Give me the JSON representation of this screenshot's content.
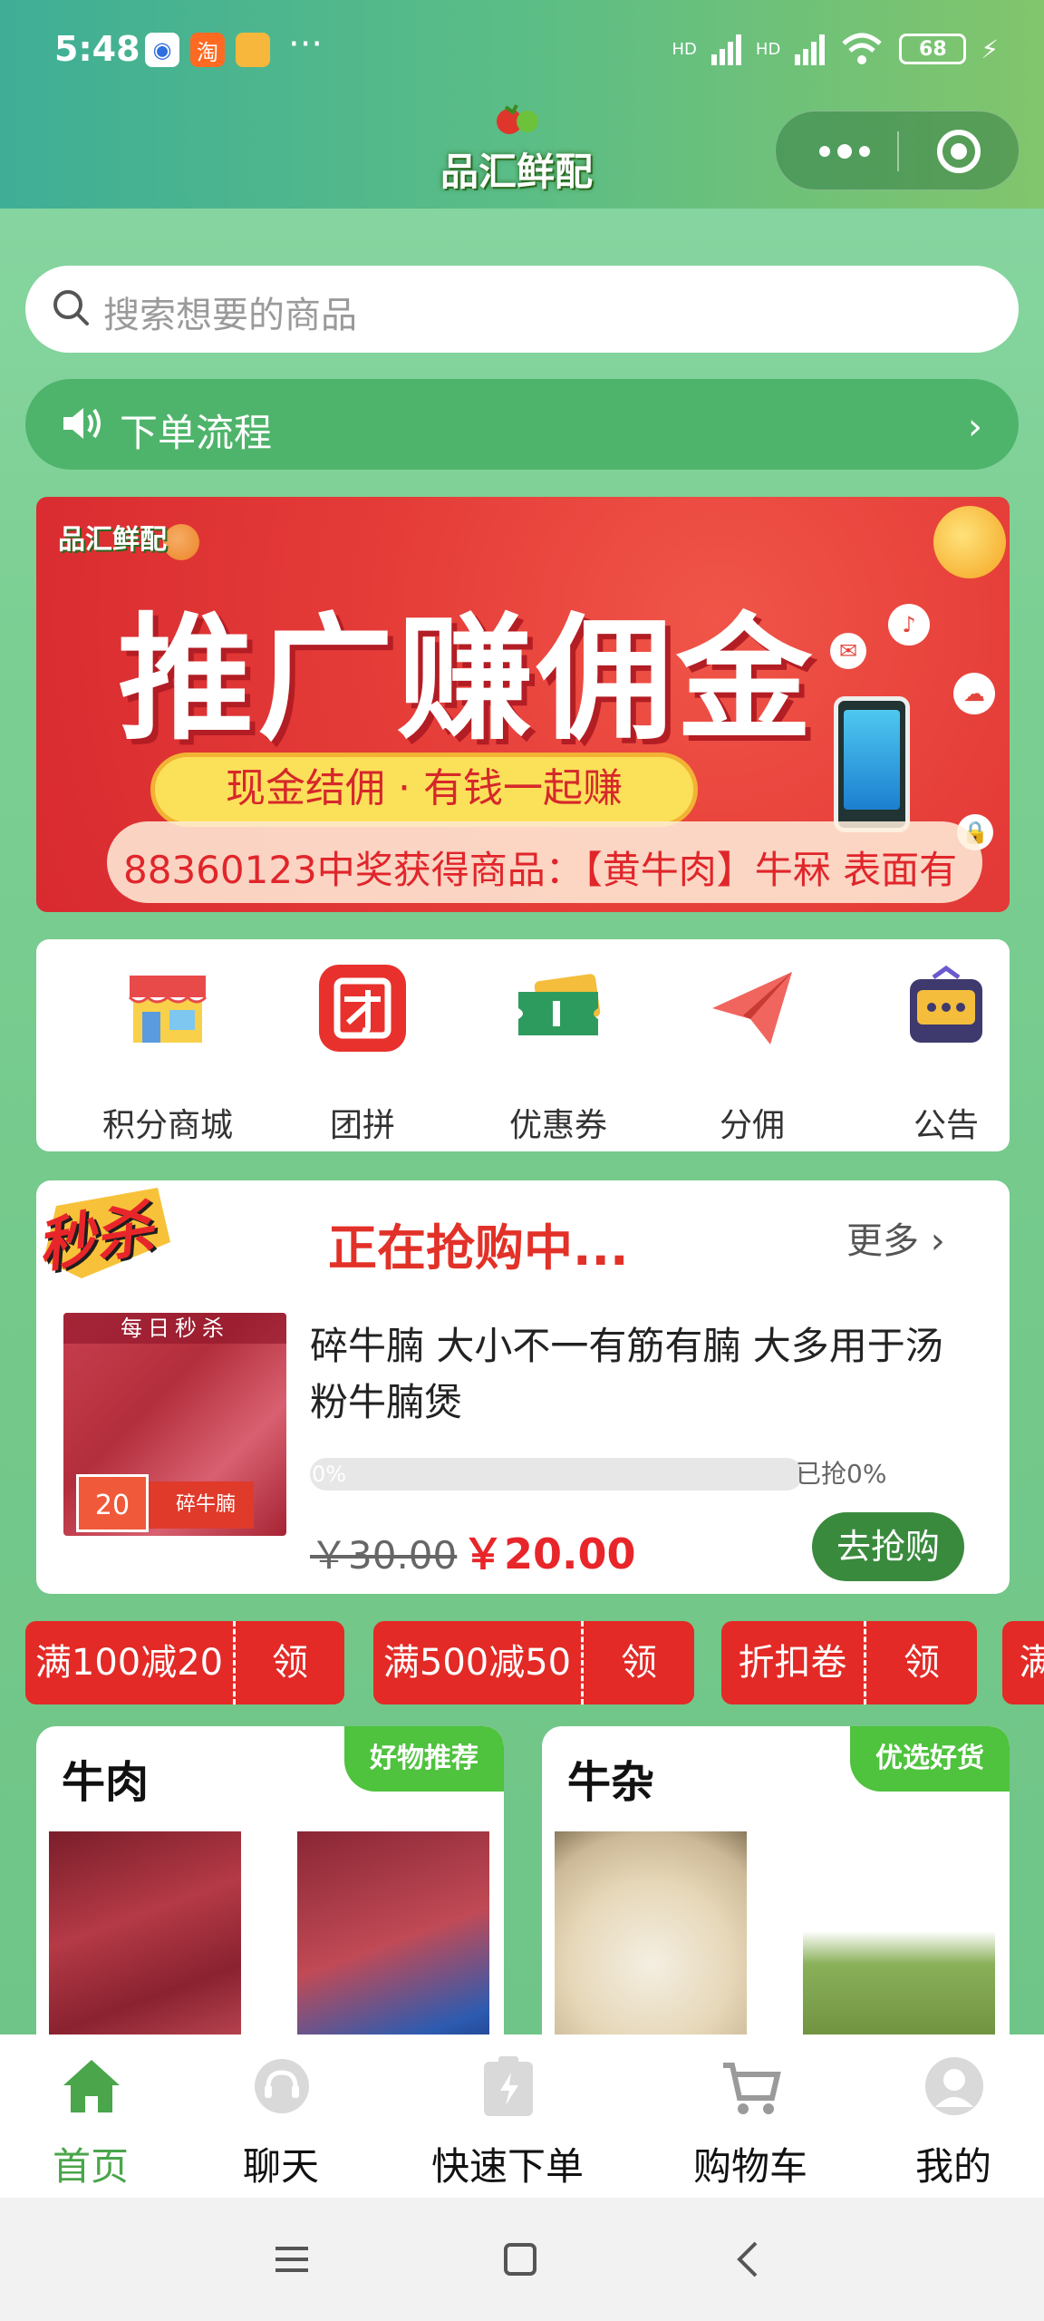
{
  "status_bar": {
    "time": "5:48",
    "battery": "68",
    "signal_labels": [
      "HD",
      "HD"
    ]
  },
  "header": {
    "brand": "品汇鲜配",
    "capsule_more_icon": "more-dots-icon",
    "capsule_close_icon": "target-icon"
  },
  "search": {
    "placeholder": "搜索想要的商品"
  },
  "notice": {
    "label": "下单流程"
  },
  "banner": {
    "logo": "品汇鲜配",
    "title": "推广赚佣金",
    "slogan": "现金结佣 · 有钱一起赚",
    "marquee": "88360123中奖获得商品：【黄牛肉】牛冧 表面有"
  },
  "quick_menu": [
    {
      "label": "积分商城",
      "icon": "shop-icon"
    },
    {
      "label": "团拼",
      "icon": "group-icon"
    },
    {
      "label": "优惠券",
      "icon": "coupon-icon"
    },
    {
      "label": "分佣",
      "icon": "paper-plane-icon"
    },
    {
      "label": "公告",
      "icon": "announcement-icon"
    }
  ],
  "flash_sale": {
    "badge": "秒杀",
    "heading": "正在抢购中...",
    "more": "更多",
    "product": {
      "thumb_tag": "每日秒杀",
      "thumb_price": "20",
      "thumb_name": "碎牛腩",
      "name": "碎牛腩 大小不一有筋有腩 大多用于汤粉牛腩煲",
      "progress_text": "0%",
      "progress": 0,
      "sold_text": "已抢0%",
      "old_price": "￥30.00",
      "new_price": "￥20.00",
      "buy_label": "去抢购"
    }
  },
  "coupons": [
    {
      "title": "满100减20",
      "action": "领"
    },
    {
      "title": "满500减50",
      "action": "领"
    },
    {
      "title": "折扣卷",
      "action": "领"
    },
    {
      "title": "满",
      "action": ""
    }
  ],
  "categories": [
    {
      "name": "牛肉",
      "ribbon": "好物推荐"
    },
    {
      "name": "牛杂",
      "ribbon": "优选好货"
    }
  ],
  "tabbar": [
    {
      "label": "首页",
      "icon": "home-icon",
      "active": true
    },
    {
      "label": "聊天",
      "icon": "chat-icon",
      "active": false
    },
    {
      "label": "快速下单",
      "icon": "quick-order-icon",
      "active": false
    },
    {
      "label": "购物车",
      "icon": "cart-icon",
      "active": false
    },
    {
      "label": "我的",
      "icon": "profile-icon",
      "active": false
    }
  ],
  "colors": {
    "primary_green": "#4aa54b",
    "sale_red": "#e32a26",
    "buy_green": "#3a8a3e"
  }
}
